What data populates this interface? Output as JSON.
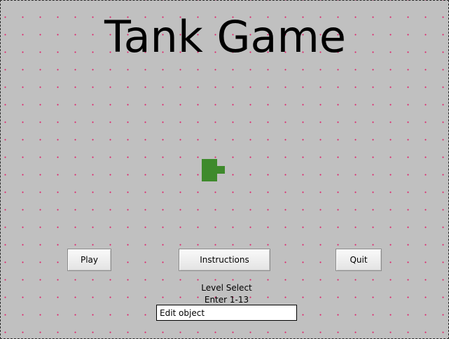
{
  "window": {
    "background_color": "#c0c0c0",
    "grid_dot_color": "#e0206a"
  },
  "title": "Tank Game",
  "tank": {
    "color": "#3e8a2c"
  },
  "buttons": {
    "play_label": "Play",
    "instructions_label": "Instructions",
    "quit_label": "Quit"
  },
  "level_select": {
    "label": "Level Select",
    "hint": "Enter 1-13",
    "input_value": "Edit object"
  }
}
